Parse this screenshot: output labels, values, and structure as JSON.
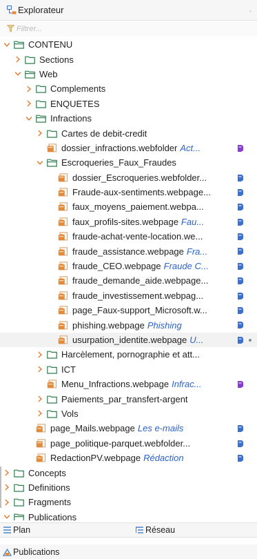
{
  "window": {
    "title": "Explorateur",
    "menu_glyph": "◦"
  },
  "filter": {
    "placeholder": "Filtrer..."
  },
  "tree": [
    {
      "label": "CONTENU",
      "sub": "",
      "depth": 0,
      "toggle": "expanded",
      "icon": "folder-open-icon"
    },
    {
      "label": "Sections",
      "sub": "",
      "depth": 1,
      "toggle": "collapsed",
      "icon": "folder-icon"
    },
    {
      "label": "Web",
      "sub": "",
      "depth": 1,
      "toggle": "expanded",
      "icon": "folder-open-icon"
    },
    {
      "label": "Complements",
      "sub": "",
      "depth": 2,
      "toggle": "collapsed",
      "icon": "folder-icon"
    },
    {
      "label": "ENQUETES",
      "sub": "",
      "depth": 2,
      "toggle": "collapsed",
      "icon": "folder-icon"
    },
    {
      "label": "Infractions",
      "sub": "",
      "depth": 2,
      "toggle": "expanded",
      "icon": "folder-open-icon"
    },
    {
      "label": "Cartes de debit-credit",
      "sub": "",
      "depth": 3,
      "toggle": "collapsed",
      "icon": "folder-icon"
    },
    {
      "label": "dossier_infractions.webfolder",
      "sub": "Act...",
      "depth": 3,
      "toggle": "none",
      "icon": "webfolder-icon",
      "trail": "purple-badge-icon"
    },
    {
      "label": "Escroqueries_Faux_Fraudes",
      "sub": "",
      "depth": 3,
      "toggle": "expanded",
      "icon": "folder-open-icon"
    },
    {
      "label": "dossier_Escroqueries.webfolder...",
      "sub": "",
      "depth": 4,
      "toggle": "none",
      "icon": "webfolder-icon",
      "trail": "blue-badge-icon"
    },
    {
      "label": "Fraude-aux-sentiments.webpage...",
      "sub": "",
      "depth": 4,
      "toggle": "none",
      "icon": "webpage-icon",
      "trail": "blue-badge-icon"
    },
    {
      "label": "faux_moyens_paiement.webpa...",
      "sub": "",
      "depth": 4,
      "toggle": "none",
      "icon": "webpage-icon",
      "trail": "blue-badge-icon"
    },
    {
      "label": "faux_profils-sites.webpage",
      "sub": "Fau...",
      "depth": 4,
      "toggle": "none",
      "icon": "webpage-icon",
      "trail": "blue-badge-icon"
    },
    {
      "label": "fraude-achat-vente-location.we...",
      "sub": "",
      "depth": 4,
      "toggle": "none",
      "icon": "webpage-icon",
      "trail": "blue-badge-icon"
    },
    {
      "label": "fraude_assistance.webpage",
      "sub": "Fra...",
      "depth": 4,
      "toggle": "none",
      "icon": "webpage-icon",
      "trail": "blue-badge-icon"
    },
    {
      "label": "fraude_CEO.webpage",
      "sub": "Fraude C...",
      "depth": 4,
      "toggle": "none",
      "icon": "webpage-icon",
      "trail": "blue-badge-icon"
    },
    {
      "label": "fraude_demande_aide.webpage...",
      "sub": "",
      "depth": 4,
      "toggle": "none",
      "icon": "webpage-icon",
      "trail": "blue-badge-icon"
    },
    {
      "label": "fraude_investissement.webpag...",
      "sub": "",
      "depth": 4,
      "toggle": "none",
      "icon": "webpage-icon",
      "trail": "blue-badge-icon"
    },
    {
      "label": "page_Faux-support_Microsoft.w...",
      "sub": "",
      "depth": 4,
      "toggle": "none",
      "icon": "webpage-icon",
      "trail": "blue-badge-icon"
    },
    {
      "label": "phishing.webpage",
      "sub": "Phishing",
      "depth": 4,
      "toggle": "none",
      "icon": "webpage-icon",
      "trail": "blue-badge-icon"
    },
    {
      "label": "usurpation_identite.webpage",
      "sub": "U...",
      "depth": 4,
      "toggle": "none",
      "icon": "webpage-icon",
      "trail": "blue-badge-icon",
      "selected": true
    },
    {
      "label": "Harcèlement, pornographie et att...",
      "sub": "",
      "depth": 3,
      "toggle": "collapsed",
      "icon": "folder-icon"
    },
    {
      "label": "ICT",
      "sub": "",
      "depth": 3,
      "toggle": "collapsed",
      "icon": "folder-icon"
    },
    {
      "label": "Menu_Infractions.webpage",
      "sub": "Infrac...",
      "depth": 3,
      "toggle": "none",
      "icon": "webpage-icon",
      "trail": "purple-badge-icon"
    },
    {
      "label": "Paiements_par_transfert-argent",
      "sub": "",
      "depth": 3,
      "toggle": "collapsed",
      "icon": "folder-icon"
    },
    {
      "label": "Vols",
      "sub": "",
      "depth": 3,
      "toggle": "collapsed",
      "icon": "folder-icon"
    },
    {
      "label": "page_Mails.webpage",
      "sub": "Les e-mails",
      "depth": 2,
      "toggle": "none",
      "icon": "webpage-icon",
      "trail": "blue-badge-icon"
    },
    {
      "label": "page_politique-parquet.webfolder...",
      "sub": "",
      "depth": 2,
      "toggle": "none",
      "icon": "webfolder-icon",
      "trail": "blue-badge-icon"
    },
    {
      "label": "RedactionPV.webpage",
      "sub": "Rédaction",
      "depth": 2,
      "toggle": "none",
      "icon": "webpage-icon",
      "trail": "blue-badge-icon"
    },
    {
      "label": "Concepts",
      "sub": "",
      "depth": 0,
      "toggle": "collapsed",
      "icon": "folder-icon"
    },
    {
      "label": "Definitions",
      "sub": "",
      "depth": 0,
      "toggle": "collapsed",
      "icon": "folder-icon"
    },
    {
      "label": "Fragments",
      "sub": "",
      "depth": 0,
      "toggle": "collapsed",
      "icon": "folder-icon"
    },
    {
      "label": "Publications",
      "sub": "",
      "depth": 0,
      "toggle": "expanded",
      "icon": "folder-open-icon"
    }
  ],
  "tabs": {
    "plan": "Plan",
    "reseau": "Réseau"
  },
  "bottom": {
    "label": "Publications"
  },
  "colors": {
    "subtitle": "#2a62c9",
    "folder_green": "#2f7d4f",
    "page_orange": "#e38a3b",
    "badge_blue": "#3b6fd0",
    "badge_purple": "#8a3bd0"
  }
}
